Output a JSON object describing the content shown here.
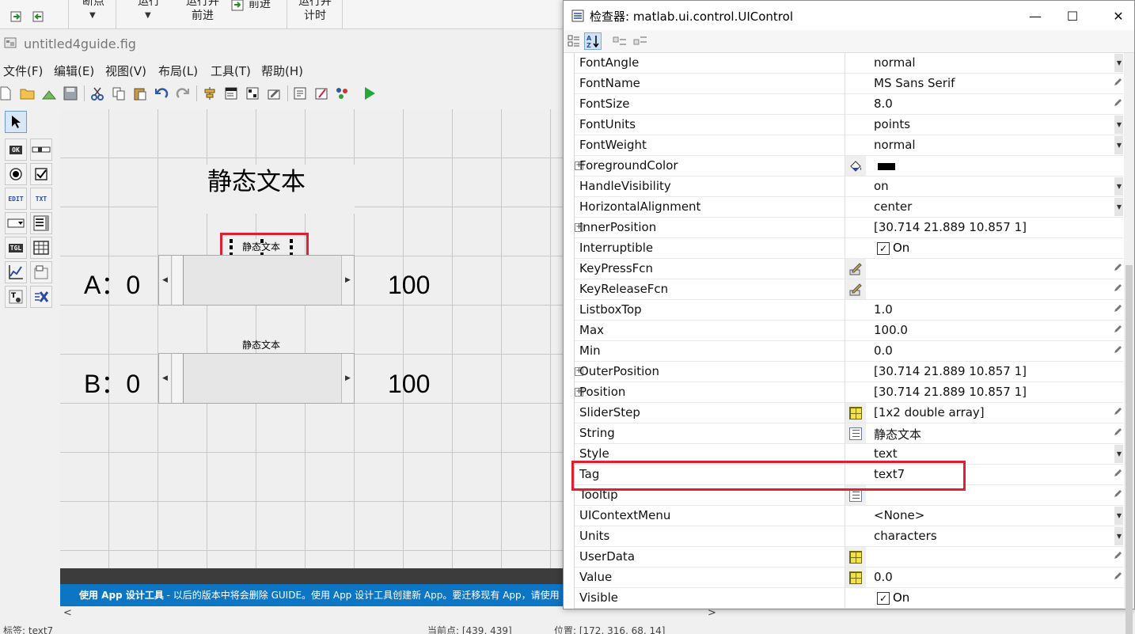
{
  "ribbon": {
    "breakpoints": "断点",
    "run": "运行",
    "run_advance_1": "运行并",
    "run_advance_2": "前进",
    "advance": "前进",
    "run_time_1": "运行并",
    "run_time_2": "计时"
  },
  "guide": {
    "title": "untitled4guide.fig",
    "menus": [
      "文件(F)",
      "编辑(E)",
      "视图(V)",
      "布局(L)",
      "工具(T)",
      "帮助(H)"
    ],
    "palette": [
      "select-tool",
      "push-button",
      "slider",
      "radio-button",
      "checkbox",
      "edit-text",
      "static-text",
      "popup-menu",
      "listbox",
      "toggle-button",
      "table",
      "axes",
      "panel",
      "button-group",
      "activex"
    ],
    "palette_labels": {
      "ok": "OK",
      "edit": "EDIT",
      "txt": "TXT",
      "tgl": "TGL"
    },
    "canvas": {
      "heading": "静态文本",
      "text_selected": "静态文本",
      "text_second": "静态文本",
      "label_a": "A：0",
      "label_b": "B：0",
      "max_a": "100",
      "max_b": "100"
    },
    "notice_bold": "使用 App 设计工具",
    "notice_text": " - 以后的版本中将会删除 GUIDE。使用 App 设计工具创建新 App。要迁移现有 App，请使用 GU",
    "status": {
      "tag": "标签: text7",
      "current_point": "当前点: [439, 439]",
      "position": "位置: [172, 316, 68, 14]"
    }
  },
  "inspector": {
    "title": "检查器:  matlab.ui.control.UIControl",
    "properties": [
      {
        "name": "FontAngle",
        "value": "normal",
        "control": "dropdown"
      },
      {
        "name": "FontName",
        "value": "MS Sans Serif",
        "control": "edit"
      },
      {
        "name": "FontSize",
        "value": "8.0",
        "control": "edit"
      },
      {
        "name": "FontUnits",
        "value": "points",
        "control": "dropdown"
      },
      {
        "name": "FontWeight",
        "value": "normal",
        "control": "dropdown"
      },
      {
        "name": "ForegroundColor",
        "value": "",
        "control": "color",
        "expandable": true,
        "icon": "paint-bucket-icon",
        "swatch": "#000000"
      },
      {
        "name": "HandleVisibility",
        "value": "on",
        "control": "dropdown"
      },
      {
        "name": "HorizontalAlignment",
        "value": "center",
        "control": "dropdown"
      },
      {
        "name": "InnerPosition",
        "value": "[30.714 21.889 10.857 1]",
        "control": "none",
        "expandable": true
      },
      {
        "name": "Interruptible",
        "value": "On",
        "control": "checkbox",
        "checked": true
      },
      {
        "name": "KeyPressFcn",
        "value": "",
        "control": "edit",
        "icon": "callback-pencil-icon"
      },
      {
        "name": "KeyReleaseFcn",
        "value": "",
        "control": "edit",
        "icon": "callback-pencil-icon"
      },
      {
        "name": "ListboxTop",
        "value": "1.0",
        "control": "edit"
      },
      {
        "name": "Max",
        "value": "100.0",
        "control": "edit"
      },
      {
        "name": "Min",
        "value": "0.0",
        "control": "edit"
      },
      {
        "name": "OuterPosition",
        "value": "[30.714 21.889 10.857 1]",
        "control": "none",
        "expandable": true
      },
      {
        "name": "Position",
        "value": "[30.714 21.889 10.857 1]",
        "control": "none",
        "expandable": true
      },
      {
        "name": "SliderStep",
        "value": "[1x2  double array]",
        "control": "edit",
        "icon": "array-editor-icon"
      },
      {
        "name": "String",
        "value": "静态文本",
        "control": "edit",
        "icon": "text-editor-icon"
      },
      {
        "name": "Style",
        "value": "text",
        "control": "dropdown"
      },
      {
        "name": "Tag",
        "value": "text7",
        "control": "edit",
        "highlight": true
      },
      {
        "name": "Tooltip",
        "value": "",
        "control": "edit",
        "icon": "text-editor-icon"
      },
      {
        "name": "UIContextMenu",
        "value": "<None>",
        "control": "dropdown"
      },
      {
        "name": "Units",
        "value": "characters",
        "control": "dropdown"
      },
      {
        "name": "UserData",
        "value": "",
        "control": "edit",
        "icon": "array-editor-icon"
      },
      {
        "name": "Value",
        "value": "0.0",
        "control": "edit",
        "icon": "array-editor-icon"
      },
      {
        "name": "Visible",
        "value": "On",
        "control": "checkbox",
        "checked": true
      }
    ]
  },
  "colors": {
    "accent_blue": "#0c76c5",
    "highlight_red": "#e02030",
    "canvas_bg": "#efefef",
    "grid_line": "#c8c8c8"
  }
}
